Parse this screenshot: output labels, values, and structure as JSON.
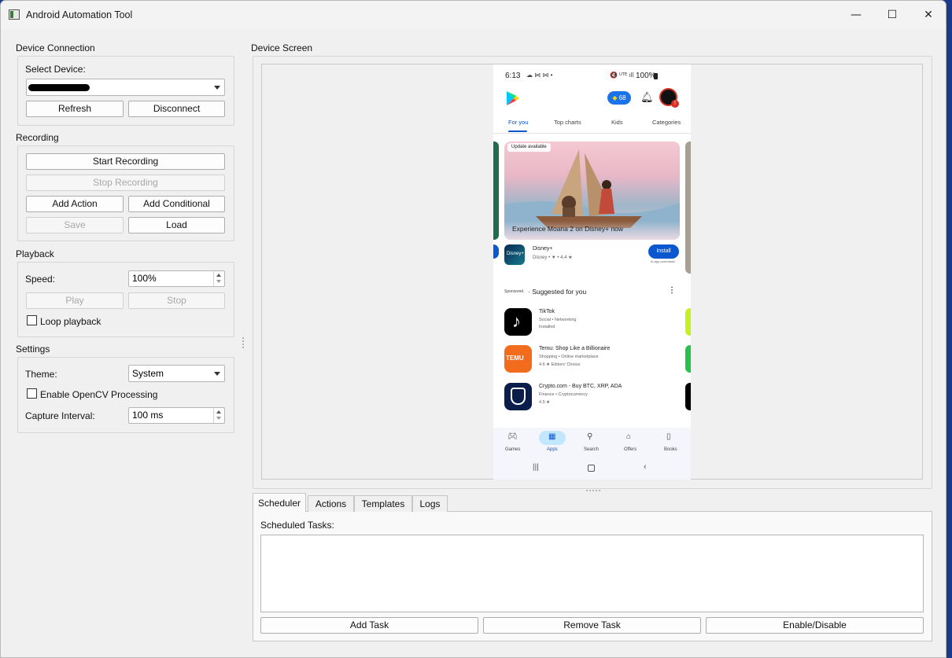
{
  "window": {
    "title": "Android Automation Tool",
    "minimize": "—",
    "maximize": "☐",
    "close": "✕"
  },
  "device_connection": {
    "title": "Device Connection",
    "select_label": "Select Device:",
    "device_value": "",
    "refresh": "Refresh",
    "disconnect": "Disconnect"
  },
  "recording": {
    "title": "Recording",
    "start": "Start Recording",
    "stop": "Stop Recording",
    "add_action": "Add Action",
    "add_conditional": "Add Conditional",
    "save": "Save",
    "load": "Load"
  },
  "playback": {
    "title": "Playback",
    "speed_label": "Speed:",
    "speed_value": "100%",
    "play": "Play",
    "stop": "Stop",
    "loop_label": "Loop playback"
  },
  "settings": {
    "title": "Settings",
    "theme_label": "Theme:",
    "theme_value": "System",
    "opencv_label": "Enable OpenCV Processing",
    "interval_label": "Capture Interval:",
    "interval_value": "100 ms"
  },
  "device_screen": {
    "title": "Device Screen",
    "phone": {
      "time": "6:13",
      "battery": "100%",
      "points": "68",
      "tabs": [
        "For you",
        "Top charts",
        "Kids",
        "Categories"
      ],
      "banner_badge": "Update available",
      "banner_text": "Experience Moana 2 on Disney+ now",
      "featured": {
        "name": "Disney+",
        "meta": "Disney • ",
        "rating": "4.4 ★",
        "install": "Install",
        "note": "In-app purchases"
      },
      "sponsored": "Sponsored",
      "suggested_title": "Suggested for you",
      "apps": [
        {
          "name": "TikTok",
          "cat": "Social • Networking",
          "extra": "Installed",
          "icon_color": "#000000"
        },
        {
          "name": "Temu: Shop Like a Billionaire",
          "cat": "Shopping • Online marketplace",
          "extra": "4.6 ★   Editors' Choice",
          "icon_color": "#f36b1c",
          "icon_text": "TEMU"
        },
        {
          "name": "Crypto.com - Buy BTC, XRP, ADA",
          "cat": "Finance • Cryptocurrency",
          "extra": "4.5 ★",
          "icon_color": "#0b1d4a"
        }
      ],
      "nav": [
        "Games",
        "Apps",
        "Search",
        "Offers",
        "Books"
      ]
    }
  },
  "bottom_tabs": [
    "Scheduler",
    "Actions",
    "Templates",
    "Logs"
  ],
  "scheduler": {
    "label": "Scheduled Tasks:",
    "add": "Add Task",
    "remove": "Remove Task",
    "toggle": "Enable/Disable"
  },
  "colors": {
    "accent": "#0b57d0",
    "window_bg": "#f0f0f0",
    "desktop": "#1b3a8c"
  }
}
